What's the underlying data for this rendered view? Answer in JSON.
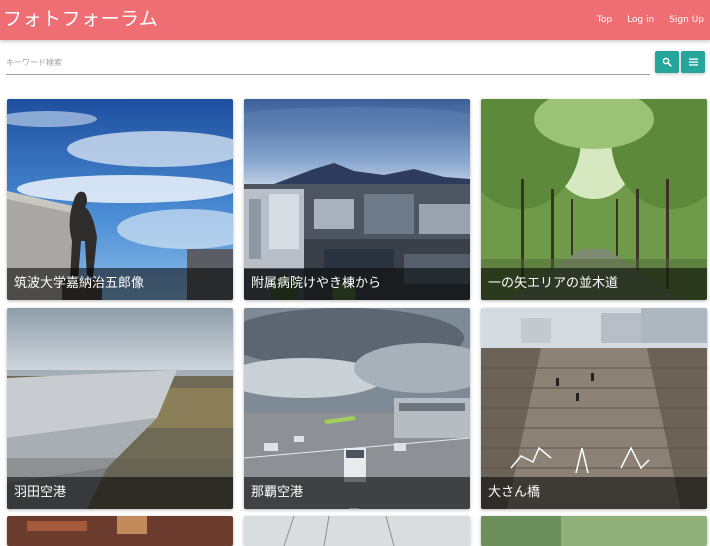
{
  "header": {
    "title": "フォトフォーラム",
    "nav": {
      "top": "Top",
      "login": "Log in",
      "signup": "Sign Up"
    }
  },
  "search": {
    "placeholder": "キーワード検索",
    "value": ""
  },
  "icons": {
    "search": "search-icon",
    "menu": "menu-icon"
  },
  "colors": {
    "navbar": "#ee6e73",
    "button": "#26a69a"
  },
  "photos": [
    {
      "caption": "筑波大学嘉納治五郎像"
    },
    {
      "caption": "附属病院けやき棟から"
    },
    {
      "caption": "一の矢エリアの並木道"
    },
    {
      "caption": "羽田空港"
    },
    {
      "caption": "那覇空港"
    },
    {
      "caption": "大さん橋"
    }
  ]
}
